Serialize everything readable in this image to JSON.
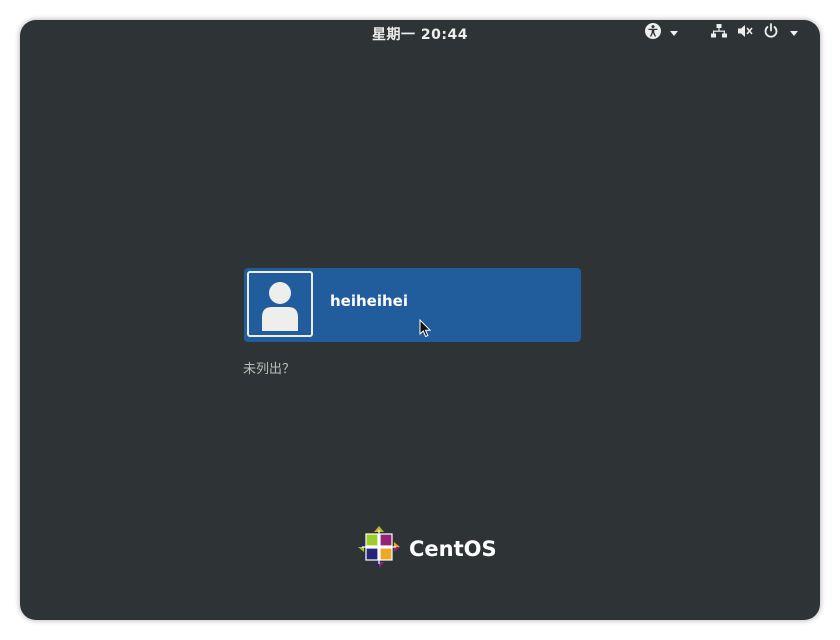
{
  "topbar": {
    "clock": "星期一 20:44",
    "icons": {
      "accessibility": "accessibility-icon",
      "network": "network-wired-icon",
      "volume": "volume-muted-icon",
      "power": "power-icon"
    }
  },
  "login": {
    "users": [
      {
        "username": "heiheihei",
        "avatar": "user-avatar-icon"
      }
    ],
    "not_listed": "未列出？"
  },
  "branding": {
    "name": "CentOS"
  },
  "colors": {
    "background": "#2e3436",
    "user_card": "#215d9c",
    "text": "#eeeeec",
    "muted_text": "#babdb6"
  }
}
